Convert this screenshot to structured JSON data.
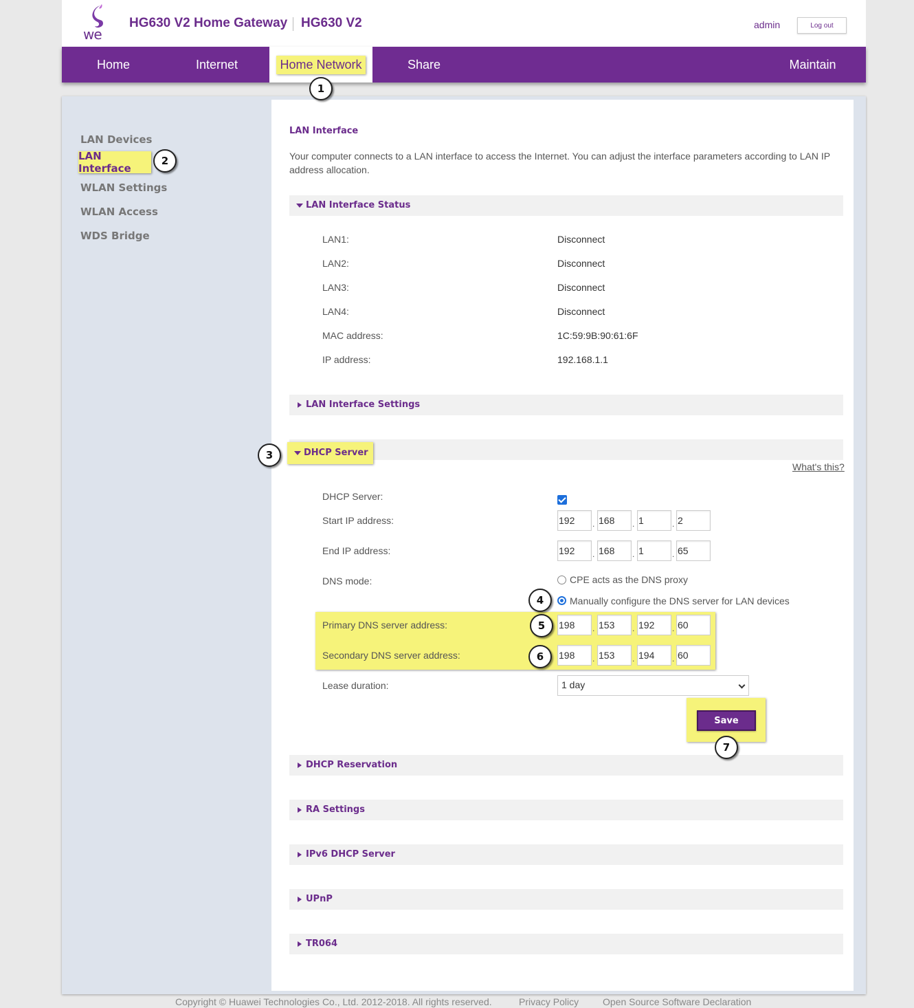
{
  "header": {
    "logo_text": "we",
    "title": "HG630 V2 Home Gateway",
    "model": "HG630 V2",
    "user": "admin",
    "logout_label": "Log out"
  },
  "nav": {
    "items": [
      {
        "label": "Home"
      },
      {
        "label": "Internet"
      },
      {
        "label": "Home Network"
      },
      {
        "label": "Share"
      },
      {
        "label": "Maintain"
      }
    ],
    "active": "Home Network"
  },
  "sidebar": {
    "items": [
      {
        "label": "LAN Devices"
      },
      {
        "label": "LAN Interface"
      },
      {
        "label": "WLAN Settings"
      },
      {
        "label": "WLAN Access"
      },
      {
        "label": "WDS Bridge"
      }
    ],
    "active": "LAN Interface"
  },
  "main": {
    "title": "LAN Interface",
    "description": "Your computer connects to a LAN interface to access the Internet. You can adjust the interface parameters according to LAN IP address allocation.",
    "status": {
      "header": "LAN Interface Status",
      "rows": [
        {
          "label": "LAN1:",
          "value": "Disconnect"
        },
        {
          "label": "LAN2:",
          "value": "Disconnect"
        },
        {
          "label": "LAN3:",
          "value": "Disconnect"
        },
        {
          "label": "LAN4:",
          "value": "Disconnect"
        },
        {
          "label": "MAC address:",
          "value": "1C:59:9B:90:61:6F"
        },
        {
          "label": "IP address:",
          "value": "192.168.1.1"
        }
      ]
    },
    "lan_settings_header": "LAN Interface Settings",
    "dhcp": {
      "header": "DHCP Server",
      "whats_this": "What's this?",
      "enabled_label": "DHCP Server:",
      "enabled": true,
      "start_label": "Start IP address:",
      "start_ip": [
        "192",
        "168",
        "1",
        "2"
      ],
      "end_label": "End IP address:",
      "end_ip": [
        "192",
        "168",
        "1",
        "65"
      ],
      "dns_mode_label": "DNS mode:",
      "dns_option_proxy": "CPE acts as the DNS proxy",
      "dns_option_manual": "Manually configure the DNS server for LAN devices",
      "dns_mode_selected": "manual",
      "primary_label": "Primary DNS server address:",
      "primary_dns": [
        "198",
        "153",
        "192",
        "60"
      ],
      "secondary_label": "Secondary DNS server address:",
      "secondary_dns": [
        "198",
        "153",
        "194",
        "60"
      ],
      "lease_label": "Lease duration:",
      "lease_value": "1 day",
      "save_label": "Save"
    },
    "collapsed_sections": [
      {
        "label": "DHCP Reservation"
      },
      {
        "label": "RA Settings"
      },
      {
        "label": "IPv6 DHCP Server"
      },
      {
        "label": "UPnP"
      },
      {
        "label": "TR064"
      }
    ]
  },
  "annotations": [
    "1",
    "2",
    "3",
    "4",
    "5",
    "6",
    "7"
  ],
  "footer": {
    "copyright": "Copyright © Huawei Technologies Co., Ltd. 2012-2018. All rights reserved.",
    "privacy": "Privacy Policy",
    "open_source": "Open Source Software Declaration"
  },
  "colors": {
    "brand_purple": "#6f2c91",
    "highlight_yellow": "#f6f37a",
    "sidebar_bg": "#dde3ec",
    "checkbox_blue": "#1d6fdb"
  }
}
